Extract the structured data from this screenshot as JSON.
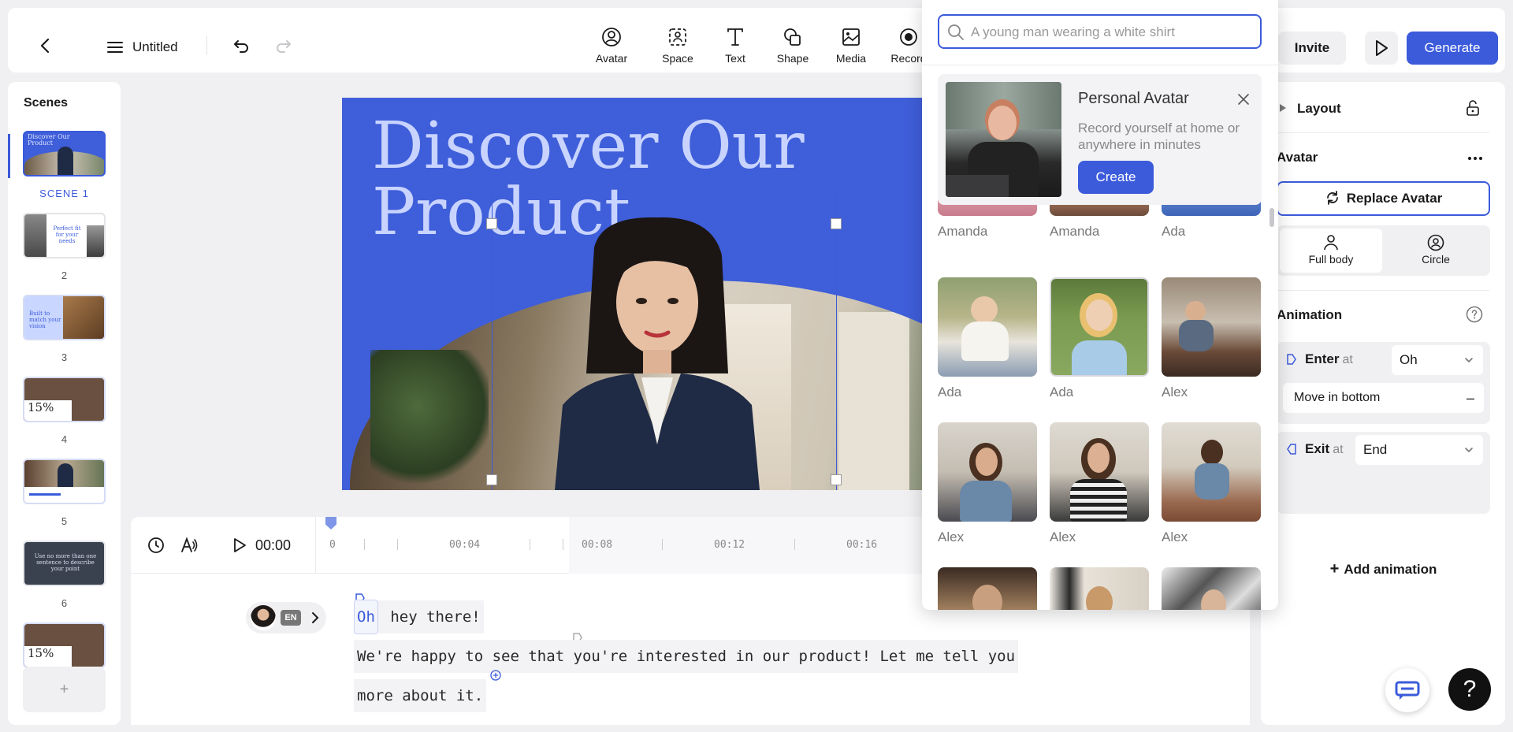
{
  "header": {
    "title": "Untitled",
    "tools": [
      {
        "label": "Avatar",
        "icon": "avatar-icon"
      },
      {
        "label": "Space",
        "icon": "space-icon"
      },
      {
        "label": "Text",
        "icon": "text-icon"
      },
      {
        "label": "Shape",
        "icon": "shape-icon"
      },
      {
        "label": "Media",
        "icon": "media-icon"
      },
      {
        "label": "Record",
        "icon": "record-icon"
      }
    ],
    "invite_label": "Invite",
    "generate_label": "Generate"
  },
  "scenes": {
    "title": "Scenes",
    "items": [
      {
        "label": "SCENE 1",
        "text": "Discover Our Product"
      },
      {
        "label": "2",
        "text": "Perfect fit for your needs"
      },
      {
        "label": "3",
        "text": "Built to match your vision"
      },
      {
        "label": "4",
        "text": "15%"
      },
      {
        "label": "5",
        "text": ""
      },
      {
        "label": "6",
        "text": "Use no more than one sentence to describe your point"
      },
      {
        "label": "",
        "text": "15%"
      }
    ],
    "add_label": "+"
  },
  "canvas": {
    "title": "Discover Our Product"
  },
  "timeline": {
    "time": "00:00",
    "ticks": [
      "0",
      "00:04",
      "00:08",
      "00:12",
      "00:16"
    ],
    "language": "EN",
    "script_word1": "Oh",
    "script_line1": " hey there!",
    "script_line2": "We're happy to see that you're interested in our product! Let me tell you",
    "script_line3": "more about it."
  },
  "avatar_picker": {
    "search_placeholder": "A young man wearing a white shirt",
    "promo": {
      "title": "Personal Avatar",
      "description": "Record yourself at home or anywhere in minutes",
      "button": "Create"
    },
    "avatars": [
      {
        "name": "Amanda"
      },
      {
        "name": "Amanda"
      },
      {
        "name": "Ada"
      },
      {
        "name": "Ada"
      },
      {
        "name": "Ada"
      },
      {
        "name": "Alex"
      },
      {
        "name": "Alex"
      },
      {
        "name": "Alex"
      },
      {
        "name": "Alex"
      },
      {
        "name": ""
      },
      {
        "name": ""
      },
      {
        "name": ""
      }
    ]
  },
  "right_panel": {
    "layout_label": "Layout",
    "avatar_label": "Avatar",
    "replace_label": "Replace Avatar",
    "shape_options": [
      "Full body",
      "Circle"
    ],
    "animation_label": "Animation",
    "enter_label": "Enter",
    "enter_at": "at",
    "enter_value": "Oh",
    "enter_effect": "Move in bottom",
    "exit_label": "Exit",
    "exit_at": "at",
    "exit_value": "End",
    "add_animation_label": "Add animation"
  },
  "colors": {
    "accent": "#3b5bdb",
    "canvas_bg": "#3f5ed9",
    "canvas_title": "#c8d4ff"
  }
}
